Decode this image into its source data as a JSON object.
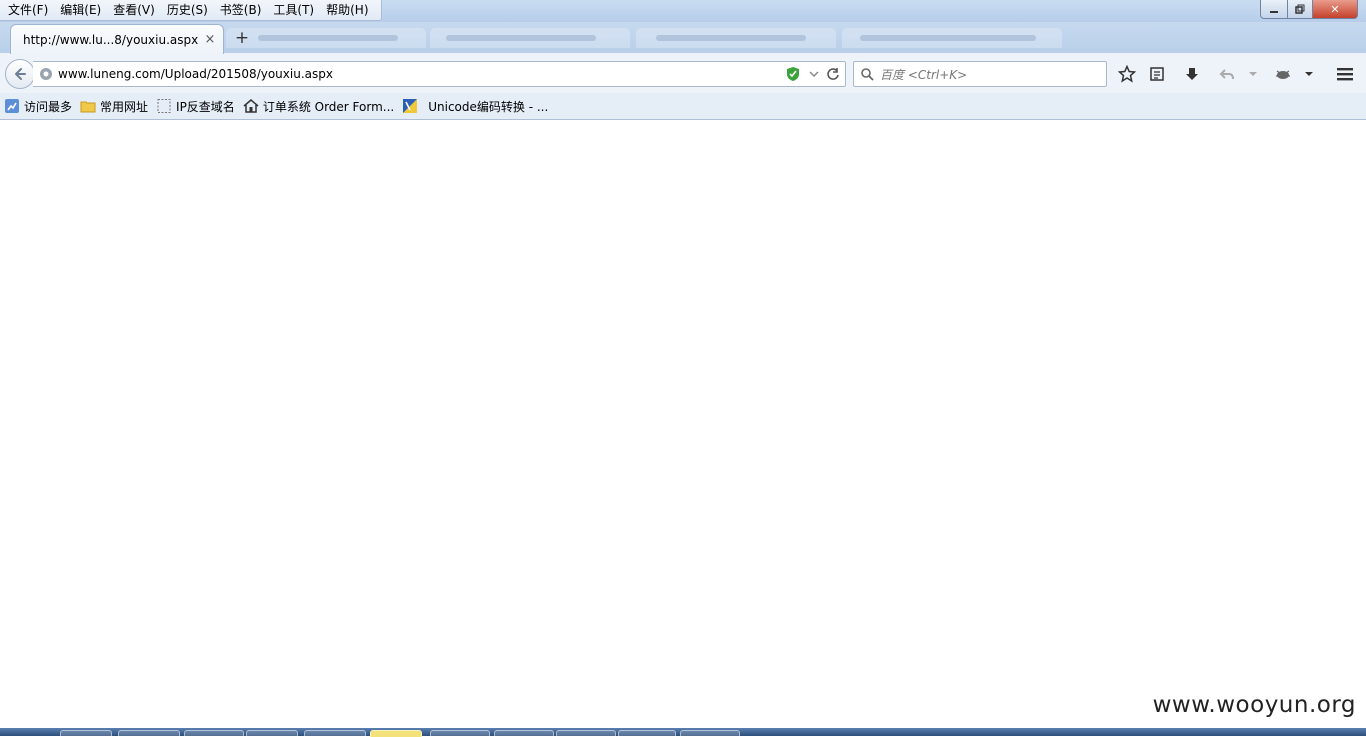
{
  "menu": {
    "items": [
      "文件(F)",
      "编辑(E)",
      "查看(V)",
      "历史(S)",
      "书签(B)",
      "工具(T)",
      "帮助(H)"
    ]
  },
  "tabs": {
    "active_title": "http://www.lu...8/youxiu.aspx",
    "close_symbol": "×",
    "new_tab_symbol": "+"
  },
  "window_controls": {
    "close_symbol": "✕"
  },
  "navbar": {
    "url": "www.luneng.com/Upload/201508/youxiu.aspx",
    "search_placeholder": "百度 <Ctrl+K>"
  },
  "bookmarks": [
    {
      "label": "访问最多",
      "icon": "most-visited-icon"
    },
    {
      "label": "常用网址",
      "icon": "folder-icon"
    },
    {
      "label": "IP反查域名",
      "icon": "blank-page-icon"
    },
    {
      "label": "订单系统 Order Form...",
      "icon": "home-icon"
    },
    {
      "label": "Unicode编码转换 - ...",
      "icon": "unicode-site-icon"
    }
  ],
  "watermark": "www.wooyun.org",
  "colors": {
    "shield": "#3aa33a",
    "titlebar": "#c9dcf1",
    "close_button": "#c4412b"
  }
}
